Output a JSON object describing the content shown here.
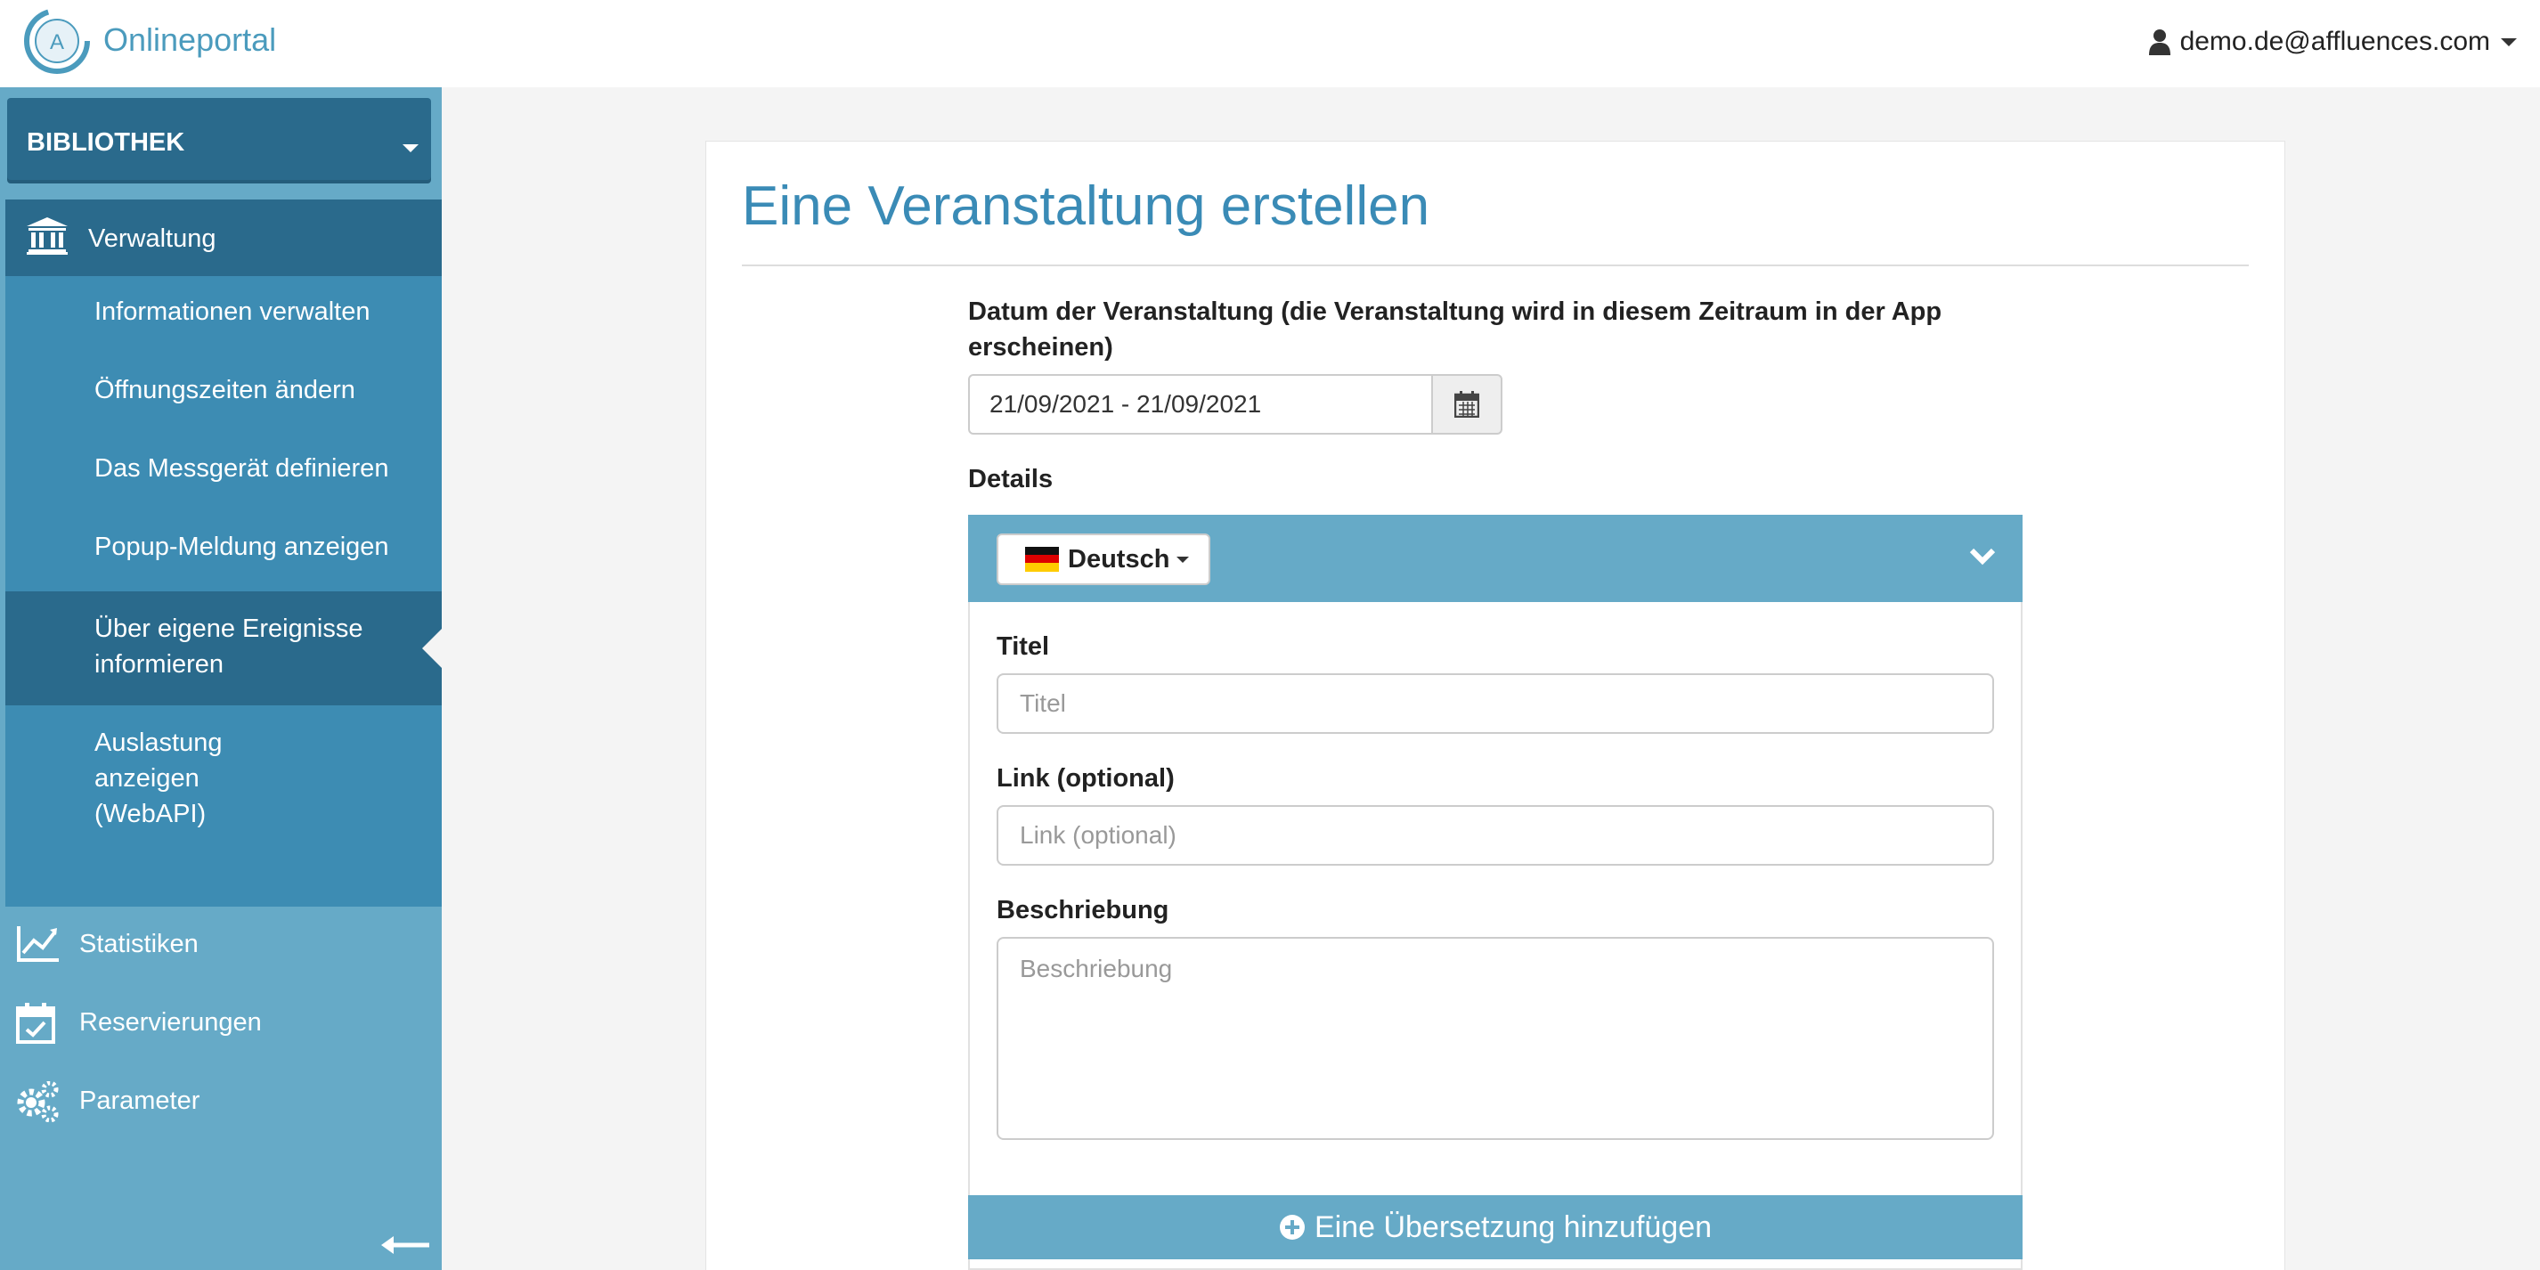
{
  "header": {
    "brand": "Onlineportal",
    "user_email": "demo.de@affluences.com"
  },
  "sidebar": {
    "library_select": "BIBLIOTHEK",
    "section": {
      "label": "Verwaltung",
      "icon": "bank-icon"
    },
    "sub_items": [
      {
        "label": "Informationen verwalten"
      },
      {
        "label": "Öffnungszeiten ändern"
      },
      {
        "label": "Das Messgerät definieren"
      },
      {
        "label": "Popup-Meldung anzeigen"
      },
      {
        "label": "Über eigene Ereignisse informieren",
        "active": true
      },
      {
        "label": "Auslastung anzeigen (WebAPI)"
      }
    ],
    "main_items": [
      {
        "label": "Statistiken",
        "icon": "chart-line-icon"
      },
      {
        "label": "Reservierungen",
        "icon": "calendar-check-icon"
      },
      {
        "label": "Parameter",
        "icon": "gears-icon"
      }
    ]
  },
  "main": {
    "title": "Eine Veranstaltung erstellen",
    "date_label": "Datum der Veranstaltung (die Veranstaltung wird in diesem Zeitraum in der App erscheinen)",
    "date_value": "21/09/2021 - 21/09/2021",
    "details_label": "Details",
    "language": "Deutsch",
    "title_label": "Titel",
    "title_placeholder": "Titel",
    "link_label": "Link (optional)",
    "link_placeholder": "Link (optional)",
    "description_label": "Beschriebung",
    "description_placeholder": "Beschriebung",
    "add_translation": "Eine Übersetzung hinzufügen"
  },
  "colors": {
    "accent": "#3a8bb6",
    "sidebar": "#66aac7",
    "sidebar_dark": "#2a6a8c",
    "sidebar_sub": "#3d8cb3"
  }
}
